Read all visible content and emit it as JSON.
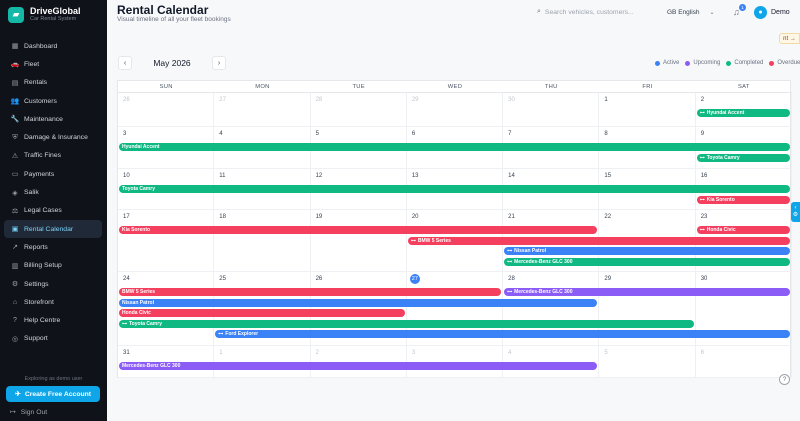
{
  "brand": {
    "title": "DriveGlobal",
    "subtitle": "Car Rental System"
  },
  "sidebar": {
    "items": [
      {
        "label": "Dashboard",
        "icon": "▦"
      },
      {
        "label": "Fleet",
        "icon": "🚗"
      },
      {
        "label": "Rentals",
        "icon": "▤"
      },
      {
        "label": "Customers",
        "icon": "👥"
      },
      {
        "label": "Maintenance",
        "icon": "🔧"
      },
      {
        "label": "Damage & Insurance",
        "icon": "⛨"
      },
      {
        "label": "Traffic Fines",
        "icon": "⚠"
      },
      {
        "label": "Payments",
        "icon": "▭"
      },
      {
        "label": "Salik",
        "icon": "◈"
      },
      {
        "label": "Legal Cases",
        "icon": "⚖"
      },
      {
        "label": "Rental Calendar",
        "icon": "▣"
      },
      {
        "label": "Reports",
        "icon": "↗"
      },
      {
        "label": "Billing Setup",
        "icon": "▥"
      },
      {
        "label": "Settings",
        "icon": "⚙"
      },
      {
        "label": "Storefront",
        "icon": "⌂"
      },
      {
        "label": "Help Centre",
        "icon": "?"
      },
      {
        "label": "Support",
        "icon": "◎"
      }
    ],
    "active_index": 10,
    "demo_note": "Exploring as demo user",
    "create_label": "Create Free Account",
    "signout_label": "Sign Out"
  },
  "header": {
    "title": "Rental Calendar",
    "subtitle": "Visual timeline of all your fleet bookings",
    "search_placeholder": "Search vehicles, customers...",
    "language": "GB English",
    "notifications": "1",
    "user": "Demo",
    "nt_chip": "nt →"
  },
  "calendar": {
    "month": "May 2026",
    "prev": "‹",
    "next": "›",
    "days": [
      "SUN",
      "MON",
      "TUE",
      "WED",
      "THU",
      "FRI",
      "SAT"
    ],
    "legend": [
      {
        "label": "Active",
        "color": "#3b82f6"
      },
      {
        "label": "Upcoming",
        "color": "#8b5cf6"
      },
      {
        "label": "Completed",
        "color": "#10b981"
      },
      {
        "label": "Overdue",
        "color": "#f43f5e"
      }
    ],
    "weeks": [
      {
        "days": [
          "26",
          "27",
          "28",
          "29",
          "30",
          "1",
          "2"
        ],
        "muted": [
          0,
          1,
          2,
          3,
          4
        ]
      },
      {
        "days": [
          "3",
          "4",
          "5",
          "6",
          "7",
          "8",
          "9"
        ],
        "muted": []
      },
      {
        "days": [
          "10",
          "11",
          "12",
          "13",
          "14",
          "15",
          "16"
        ],
        "muted": []
      },
      {
        "days": [
          "17",
          "18",
          "19",
          "20",
          "21",
          "22",
          "23"
        ],
        "muted": []
      },
      {
        "days": [
          "24",
          "25",
          "26",
          "27",
          "28",
          "29",
          "30"
        ],
        "muted": [],
        "today": 3
      },
      {
        "days": [
          "31",
          "1",
          "2",
          "3",
          "4",
          "5",
          "6"
        ],
        "muted": [
          1,
          2,
          3,
          4,
          5,
          6
        ]
      }
    ],
    "events": [
      {
        "week": 0,
        "lane": 0,
        "start": 6,
        "end": 6,
        "label": "Hyundai Accent",
        "color": "green",
        "icon": true
      },
      {
        "week": 1,
        "lane": 0,
        "start": 0,
        "end": 6,
        "label": "Hyundai Accent",
        "color": "green",
        "icon": false
      },
      {
        "week": 1,
        "lane": 1,
        "start": 6,
        "end": 6,
        "label": "Toyota Camry",
        "color": "green",
        "icon": true
      },
      {
        "week": 2,
        "lane": 0,
        "start": 0,
        "end": 6,
        "label": "Toyota Camry",
        "color": "green",
        "icon": false
      },
      {
        "week": 2,
        "lane": 1,
        "start": 6,
        "end": 6,
        "label": "Kia Sorento",
        "color": "red",
        "icon": true
      },
      {
        "week": 3,
        "lane": 0,
        "start": 0,
        "end": 4,
        "label": "Kia Sorento",
        "color": "red",
        "icon": false
      },
      {
        "week": 3,
        "lane": 0,
        "start": 6,
        "end": 6,
        "label": "Honda Civic",
        "color": "red",
        "icon": true
      },
      {
        "week": 3,
        "lane": 1,
        "start": 3,
        "end": 6,
        "label": "BMW 5 Series",
        "color": "red",
        "icon": true
      },
      {
        "week": 3,
        "lane": 2,
        "start": 4,
        "end": 6,
        "label": "Nissan Patrol",
        "color": "blue",
        "icon": true
      },
      {
        "week": 3,
        "lane": 3,
        "start": 4,
        "end": 6,
        "label": "Mercedes-Benz GLC 300",
        "color": "green",
        "icon": true
      },
      {
        "week": 4,
        "lane": 0,
        "start": 0,
        "end": 3,
        "label": "BMW 5 Series",
        "color": "red",
        "icon": false
      },
      {
        "week": 4,
        "lane": 0,
        "start": 4,
        "end": 6,
        "label": "Mercedes-Benz GLC 300",
        "color": "purple",
        "icon": true
      },
      {
        "week": 4,
        "lane": 1,
        "start": 0,
        "end": 4,
        "label": "Nissan Patrol",
        "color": "blue",
        "icon": false
      },
      {
        "week": 4,
        "lane": 2,
        "start": 0,
        "end": 2,
        "label": "Honda Civic",
        "color": "red",
        "icon": false
      },
      {
        "week": 4,
        "lane": 3,
        "start": 0,
        "end": 5,
        "label": "Toyota Camry",
        "color": "green",
        "icon": true
      },
      {
        "week": 4,
        "lane": 4,
        "start": 1,
        "end": 6,
        "label": "Ford Explorer",
        "color": "blue",
        "icon": true
      },
      {
        "week": 5,
        "lane": 0,
        "start": 0,
        "end": 4,
        "label": "Mercedes-Benz GLC 300",
        "color": "purple",
        "icon": false
      }
    ]
  },
  "side_tab": "‹ ⚙",
  "help": "?"
}
